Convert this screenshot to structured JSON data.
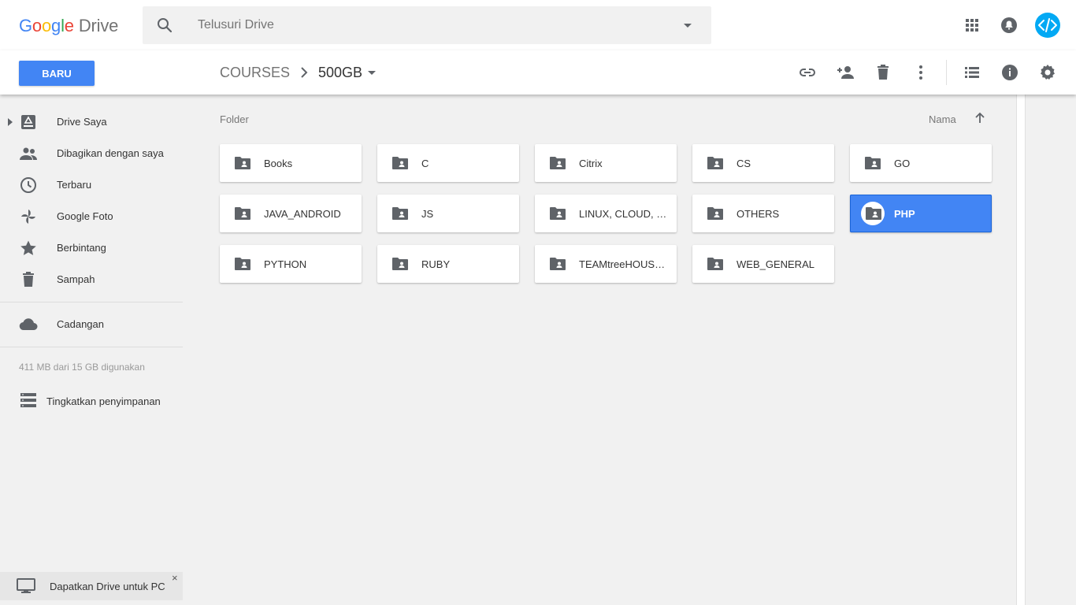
{
  "header": {
    "logo_google": [
      "G",
      "o",
      "o",
      "g",
      "l",
      "e"
    ],
    "logo_product": "Drive",
    "search_placeholder": "Telusuri Drive",
    "icons": [
      "apps-grid-icon",
      "notifications-icon",
      "account-avatar"
    ]
  },
  "toolbar": {
    "new_button": "BARU",
    "breadcrumb_parent": "COURSES",
    "breadcrumb_current": "500GB",
    "actions": [
      "get-link-icon",
      "share-icon",
      "delete-icon",
      "more-icon",
      "list-view-icon",
      "info-icon",
      "settings-icon"
    ]
  },
  "sidebar": {
    "items": [
      {
        "label": "Drive Saya",
        "icon": "my-drive-icon"
      },
      {
        "label": "Dibagikan dengan saya",
        "icon": "shared-icon"
      },
      {
        "label": "Terbaru",
        "icon": "recent-icon"
      },
      {
        "label": "Google Foto",
        "icon": "photos-icon"
      },
      {
        "label": "Berbintang",
        "icon": "star-icon"
      },
      {
        "label": "Sampah",
        "icon": "trash-icon"
      }
    ],
    "backup": {
      "label": "Cadangan",
      "icon": "cloud-icon"
    },
    "storage_text": "411 MB dari 15 GB digunakan",
    "upgrade": {
      "label": "Tingkatkan penyimpanan",
      "icon": "storage-icon"
    },
    "promo": {
      "label": "Dapatkan Drive untuk PC",
      "close": "×"
    }
  },
  "main": {
    "section_label": "Folder",
    "sort_label": "Nama",
    "folders": [
      {
        "name": "Books",
        "selected": false
      },
      {
        "name": "C",
        "selected": false
      },
      {
        "name": "Citrix",
        "selected": false
      },
      {
        "name": "CS",
        "selected": false
      },
      {
        "name": "GO",
        "selected": false
      },
      {
        "name": "JAVA_ANDROID",
        "selected": false
      },
      {
        "name": "JS",
        "selected": false
      },
      {
        "name": "LINUX, CLOUD, D...",
        "selected": false
      },
      {
        "name": "OTHERS",
        "selected": false
      },
      {
        "name": "PHP",
        "selected": true
      },
      {
        "name": "PYTHON",
        "selected": false
      },
      {
        "name": "RUBY",
        "selected": false
      },
      {
        "name": "TEAMtreeHOUSE...",
        "selected": false
      },
      {
        "name": "WEB_GENERAL",
        "selected": false
      }
    ]
  },
  "colors": {
    "accent": "#4285f4",
    "icon_gray": "#757575",
    "avatar_bg": "#03a9f4"
  }
}
